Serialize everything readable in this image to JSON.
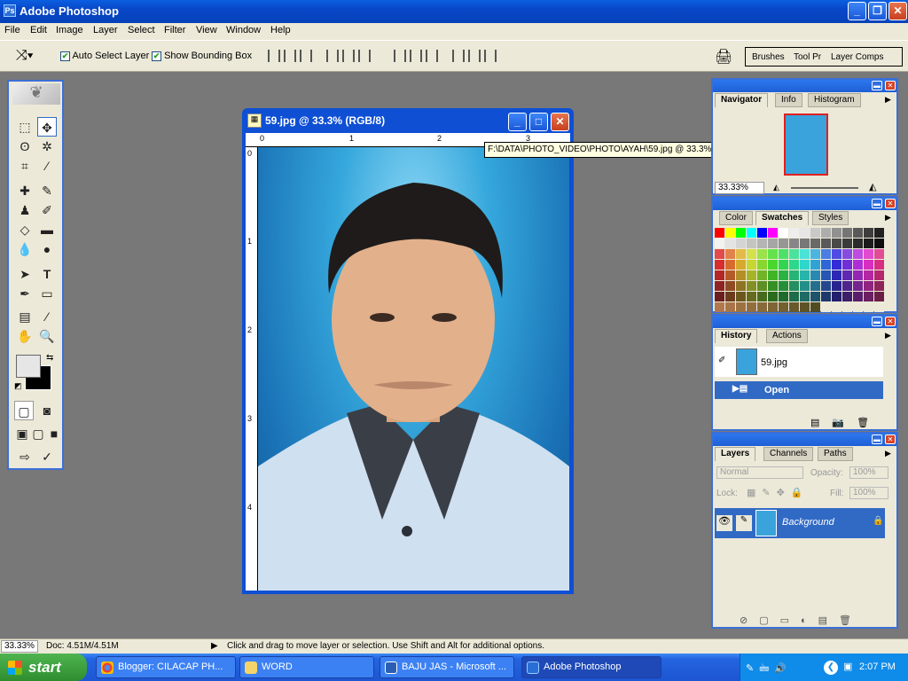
{
  "window": {
    "title": "Adobe Photoshop",
    "min": "_",
    "max": "❐",
    "close": "✕"
  },
  "menu": [
    "File",
    "Edit",
    "Image",
    "Layer",
    "Select",
    "Filter",
    "View",
    "Window",
    "Help"
  ],
  "options": {
    "auto_select": "Auto Select Layer",
    "bounding_box": "Show Bounding Box"
  },
  "wells": {
    "brushes": "Brushes",
    "tool_presets": "Tool Pr",
    "layer_comps": "Layer Comps"
  },
  "document": {
    "title": "59.jpg @ 33.3% (RGB/8)",
    "ruler_h": [
      "0",
      "1",
      "2",
      "3"
    ],
    "ruler_v": [
      "0",
      "1",
      "2",
      "3",
      "4"
    ]
  },
  "tooltip": "F:\\DATA\\PHOTO_VIDEO\\PHOTO\\AYAH\\59.jpg @ 33.3% (RGB/8)",
  "navigator": {
    "tabs": [
      "Navigator",
      "Info",
      "Histogram"
    ],
    "zoom": "33.33%"
  },
  "swatches": {
    "tabs": [
      "Color",
      "Swatches",
      "Styles"
    ]
  },
  "history": {
    "tabs": [
      "History",
      "Actions"
    ],
    "snapshot": "59.jpg",
    "step": "Open"
  },
  "layers": {
    "tabs": [
      "Layers",
      "Channels",
      "Paths"
    ],
    "blend": "Normal",
    "opacity_label": "Opacity:",
    "opacity": "100%",
    "lock_label": "Lock:",
    "fill_label": "Fill:",
    "fill": "100%",
    "layer": "Background"
  },
  "status": {
    "zoom": "33.33%",
    "doc": "Doc: 4.51M/4.51M",
    "hint": "Click and drag to move layer or selection.  Use Shift and Alt for additional options."
  },
  "taskbar": {
    "start": "start",
    "items": [
      "Blogger: CILACAP PH...",
      "WORD",
      "BAJU JAS - Microsoft ...",
      "Adobe Photoshop"
    ],
    "clock": "2:07 PM"
  },
  "colors": {
    "xp_blue": "#0a5fe0",
    "panel_bg": "#ece9d8",
    "selected": "#316ac5",
    "workspace": "#787878"
  }
}
